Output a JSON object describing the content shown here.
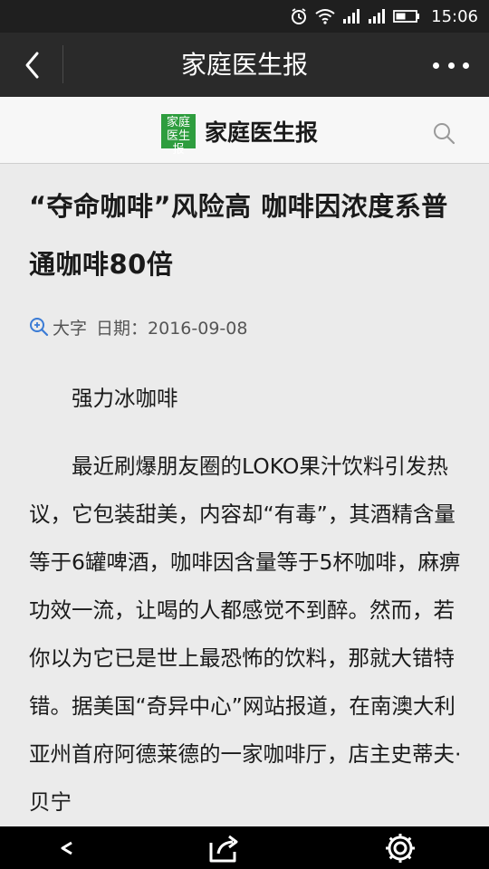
{
  "status_bar": {
    "time": "15:06",
    "icons": [
      "alarm-icon",
      "wifi-icon",
      "signal-icon",
      "signal-icon",
      "battery-icon"
    ]
  },
  "nav": {
    "title": "家庭医生报",
    "back_icon": "chevron-left-icon",
    "more_icon": "more-dots-icon"
  },
  "site_header": {
    "logo_text": "家庭医生报",
    "name": "家庭医生报",
    "search_icon": "search-icon"
  },
  "article": {
    "title": "“夺命咖啡”风险高 咖啡因浓度系普通咖啡80倍",
    "font_size_label": "大字",
    "date_label": "日期：2016-09-08",
    "subhead": "强力冰咖啡",
    "paragraph": "最近刷爆朋友圈的LOKO果汁饮料引发热议，它包装甜美，内容却“有毒”，其酒精含量等于6罐啤酒，咖啡因含量等于5杯咖啡，麻痹功效一流，让喝的人都感觉不到醉。然而，若你以为它已是世上最恐怖的饮料，那就大错特错。据美国“奇异中心”网站报道，在南澳大利亚州首府阿德莱德的一家咖啡厅，店主史蒂夫·贝宁"
  },
  "bottom_bar": {
    "icons": [
      "back-arrow-icon",
      "share-icon",
      "settings-gear-icon"
    ]
  },
  "colors": {
    "status_bg": "#1f1f1f",
    "nav_bg": "#2a2a2a",
    "page_bg": "#ebebeb",
    "logo_green": "#2e9d3e",
    "accent_blue": "#3a7bd5"
  }
}
